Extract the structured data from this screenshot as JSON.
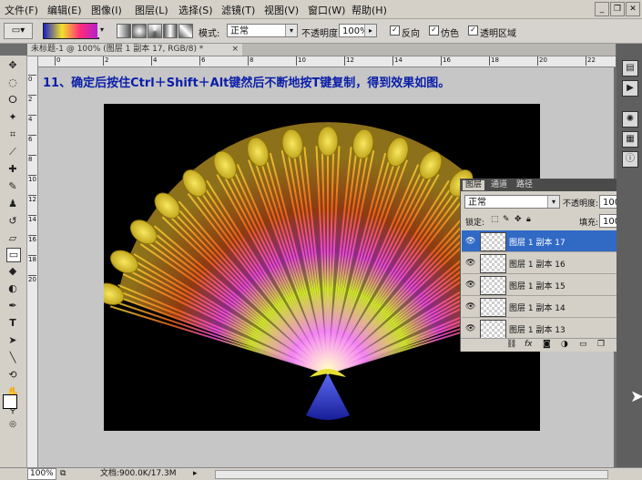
{
  "menu": [
    "文件(F)",
    "编辑(E)",
    "图像(I)",
    "图层(L)",
    "选择(S)",
    "滤镜(T)",
    "视图(V)",
    "窗口(W)",
    "帮助(H)"
  ],
  "options": {
    "mode_label": "模式:",
    "mode_value": "正常",
    "opacity_label": "不透明度:",
    "opacity_value": "100%",
    "reverse_label": "反向",
    "dither_label": "仿色",
    "transparency_label": "透明区域",
    "gradient_colors": [
      "#1a20c8",
      "#f2e22a",
      "#ff2a7a",
      "#b020d0"
    ]
  },
  "document": {
    "tab_title": "未标题-1 @ 100% (图层 1 副本 17, RGB/8) *",
    "heading": "11、确定后按住Ctrl＋Shift＋Alt键然后不断地按T键复制，得到效果如图。",
    "ruler_ticks": [
      "0",
      "2",
      "4",
      "6",
      "8",
      "10",
      "12",
      "14",
      "16",
      "18",
      "20",
      "22"
    ],
    "vruler_ticks": [
      "0",
      "2",
      "4",
      "6",
      "8",
      "10",
      "12",
      "14",
      "16",
      "18",
      "20"
    ]
  },
  "layers_panel": {
    "tabs": [
      "图层",
      "通道",
      "路径"
    ],
    "blend_mode": "正常",
    "opacity_label": "不透明度:",
    "opacity_value": "100%",
    "lock_label": "锁定:",
    "fill_label": "填充:",
    "fill_value": "100%",
    "layers": [
      {
        "name": "图层 1 副本 17",
        "selected": true
      },
      {
        "name": "图层 1 副本 16",
        "selected": false
      },
      {
        "name": "图层 1 副本 15",
        "selected": false
      },
      {
        "name": "图层 1 副本 14",
        "selected": false
      },
      {
        "name": "图层 1 副本 13",
        "selected": false
      }
    ]
  },
  "status": {
    "zoom": "100%",
    "doc_info": "文档:900.0K/17.3M"
  }
}
